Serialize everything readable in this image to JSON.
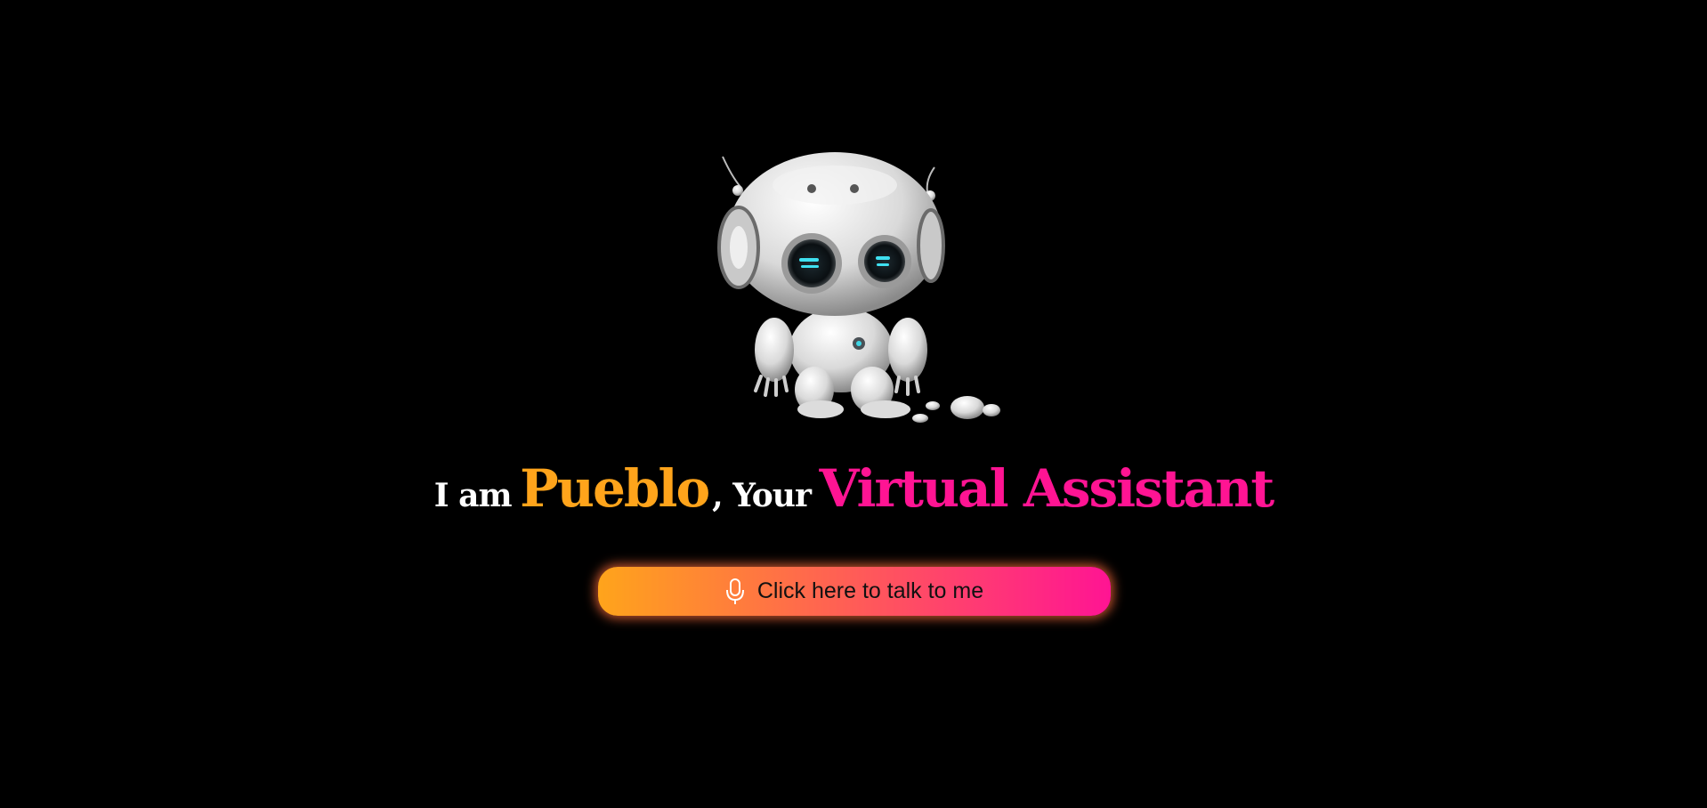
{
  "headline": {
    "prefix": "I am",
    "name": "Pueblo",
    "middle": ", Your",
    "accent": "Virtual Assistant"
  },
  "talk_button": {
    "label": "Click here to talk to me",
    "icon": "microphone-icon"
  },
  "colors": {
    "background": "#000000",
    "name_color": "#FFA41B",
    "accent_color": "#FF1493",
    "button_gradient_start": "#FFA41B",
    "button_gradient_end": "#FF1493"
  },
  "image": {
    "subject": "robot-mascot"
  }
}
